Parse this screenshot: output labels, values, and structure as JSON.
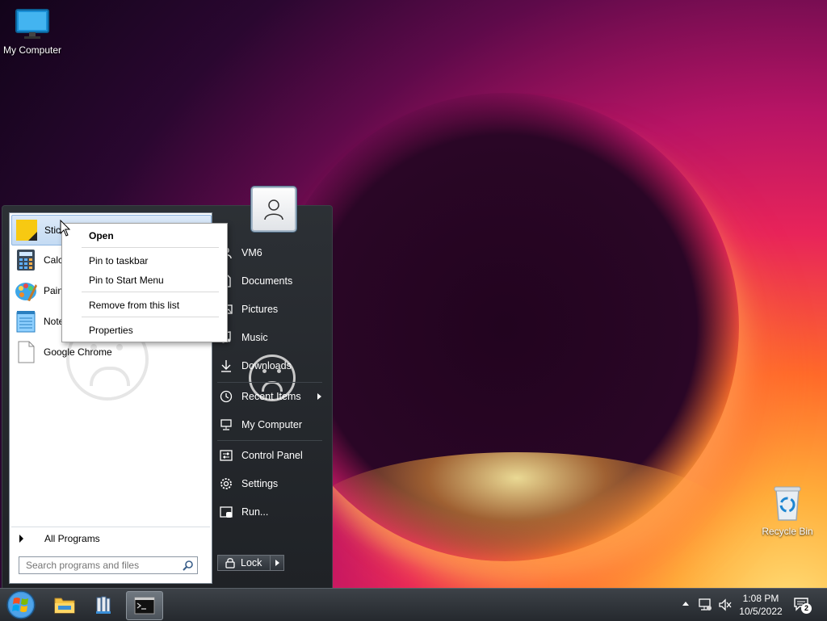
{
  "desktop": {
    "icons": [
      {
        "name": "my-computer",
        "label": "My Computer"
      },
      {
        "name": "recycle-bin",
        "label": "Recycle Bin"
      }
    ]
  },
  "start_menu": {
    "programs": [
      {
        "label": "Stick",
        "icon": "sticky-notes-icon"
      },
      {
        "label": "Calc",
        "icon": "calculator-icon"
      },
      {
        "label": "Paint",
        "icon": "paint-icon"
      },
      {
        "label": "Note",
        "icon": "notepad-icon"
      },
      {
        "label": "Google Chrome",
        "icon": "document-icon"
      }
    ],
    "all_programs": "All Programs",
    "search_placeholder": "Search programs and files",
    "right_items": [
      {
        "label": "VM6",
        "icon": "user-icon"
      },
      {
        "label": "Documents",
        "icon": "documents-icon"
      },
      {
        "label": "Pictures",
        "icon": "pictures-icon"
      },
      {
        "label": "Music",
        "icon": "music-icon"
      },
      {
        "label": "Downloads",
        "icon": "download-icon"
      },
      {
        "label": "Recent Items",
        "icon": "clock-icon"
      },
      {
        "label": "My Computer",
        "icon": "computer-icon"
      },
      {
        "label": "Control Panel",
        "icon": "control-panel-icon"
      },
      {
        "label": "Settings",
        "icon": "gear-icon"
      },
      {
        "label": "Run...",
        "icon": "run-icon"
      }
    ],
    "lock": "Lock"
  },
  "context_menu": {
    "open": "Open",
    "pin_taskbar": "Pin to taskbar",
    "pin_start": "Pin to Start Menu",
    "remove": "Remove from this list",
    "properties": "Properties"
  },
  "taskbar": {
    "time": "1:08 PM",
    "date": "10/5/2022",
    "notifications": "2"
  }
}
